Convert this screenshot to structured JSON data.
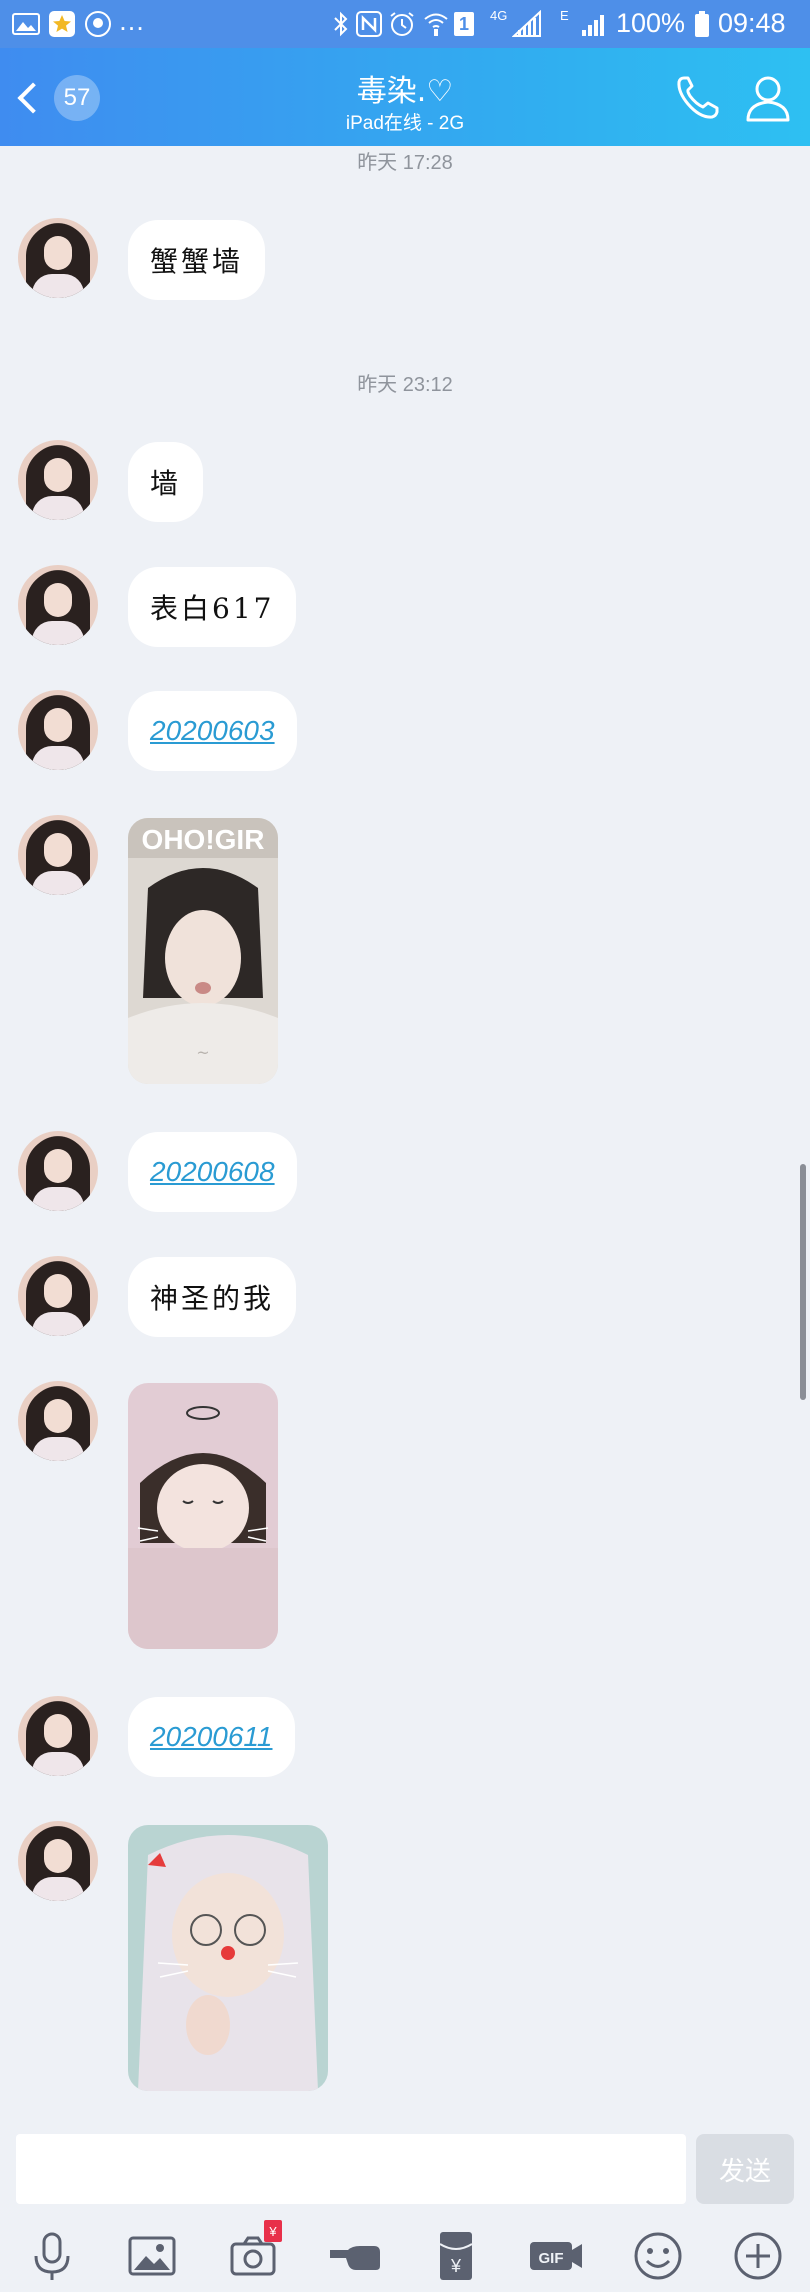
{
  "status_bar": {
    "battery": "100%",
    "time": "09:48",
    "network_type": "4G",
    "sim_slot": "1",
    "edge_indicator": "E"
  },
  "header": {
    "unread_count": "57",
    "contact_name": "毒染.♡",
    "status": "iPad在线 - 2G"
  },
  "messages": {
    "ts1": "昨天 17:28",
    "m1": "蟹蟹墙",
    "ts2": "昨天 23:12",
    "m2": "墙",
    "m3": "表白617",
    "m4": "20200603",
    "photo1_caption": "OHO!GIR",
    "m5": "20200608",
    "m6": "神圣的我",
    "m7": "20200611"
  },
  "input": {
    "placeholder": "",
    "send_label": "发送"
  },
  "toolbar": {
    "items": [
      "voice-icon",
      "image-icon",
      "camera-icon",
      "poke-icon",
      "red-packet-icon",
      "gif-icon",
      "emoji-icon",
      "plus-icon"
    ],
    "gif_label": "GIF",
    "red_packet_symbol": "¥",
    "camera_badge": "¥"
  },
  "colors": {
    "header_start": "#3f8cf0",
    "header_end": "#2ec0f2",
    "link": "#2a9bd3",
    "background": "#eef1f6"
  }
}
